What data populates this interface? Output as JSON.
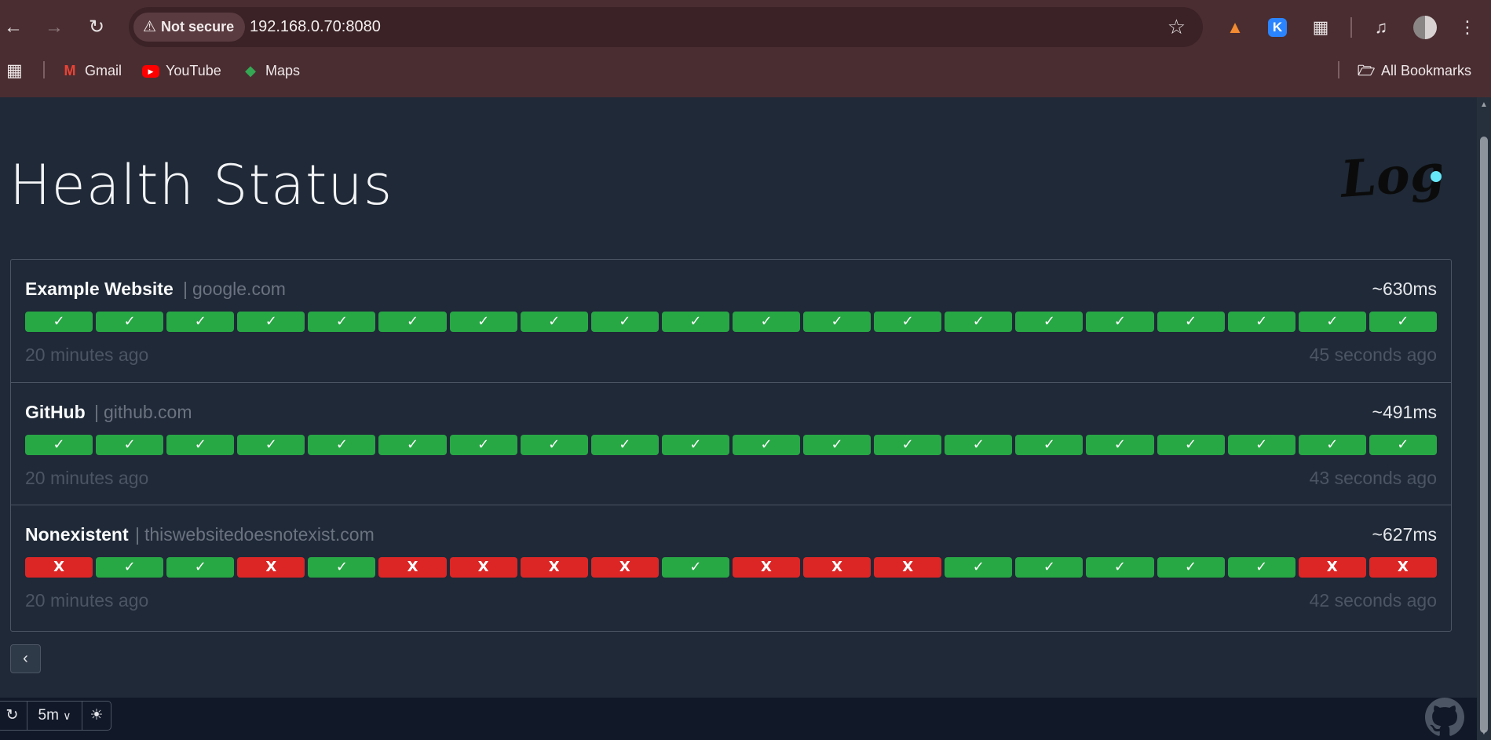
{
  "browser": {
    "security_label": "Not secure",
    "url": "192.168.0.70:8080",
    "extension_k_label": "K",
    "bookmarks": [
      {
        "label": "Gmail",
        "icon": "gmail-icon"
      },
      {
        "label": "YouTube",
        "icon": "youtube-icon"
      },
      {
        "label": "Maps",
        "icon": "maps-icon"
      }
    ],
    "all_bookmarks_label": "All Bookmarks"
  },
  "page": {
    "title": "Health Status",
    "logo_text": "Logo"
  },
  "services": [
    {
      "name": "Example Website",
      "host": "google.com",
      "latency": "~630ms",
      "oldest": "20 minutes ago",
      "newest": "45 seconds ago",
      "results": [
        true,
        true,
        true,
        true,
        true,
        true,
        true,
        true,
        true,
        true,
        true,
        true,
        true,
        true,
        true,
        true,
        true,
        true,
        true,
        true
      ]
    },
    {
      "name": "GitHub",
      "host": "github.com",
      "latency": "~491ms",
      "oldest": "20 minutes ago",
      "newest": "43 seconds ago",
      "results": [
        true,
        true,
        true,
        true,
        true,
        true,
        true,
        true,
        true,
        true,
        true,
        true,
        true,
        true,
        true,
        true,
        true,
        true,
        true,
        true
      ]
    },
    {
      "name": "Nonexistent",
      "host": "thiswebsitedoesnotexist.com",
      "latency": "~627ms",
      "oldest": "20 minutes ago",
      "newest": "42 seconds ago",
      "results": [
        false,
        true,
        true,
        false,
        true,
        false,
        false,
        false,
        false,
        true,
        false,
        false,
        false,
        true,
        true,
        true,
        true,
        true,
        false,
        false
      ]
    }
  ],
  "symbols": {
    "ok": "✓",
    "fail": "X"
  },
  "colors": {
    "ok": "#28a745",
    "fail": "#dc2626",
    "page_bg": "#1f2937",
    "chrome_bg": "#4a2d31"
  },
  "footer": {
    "refresh_interval": "5m"
  }
}
